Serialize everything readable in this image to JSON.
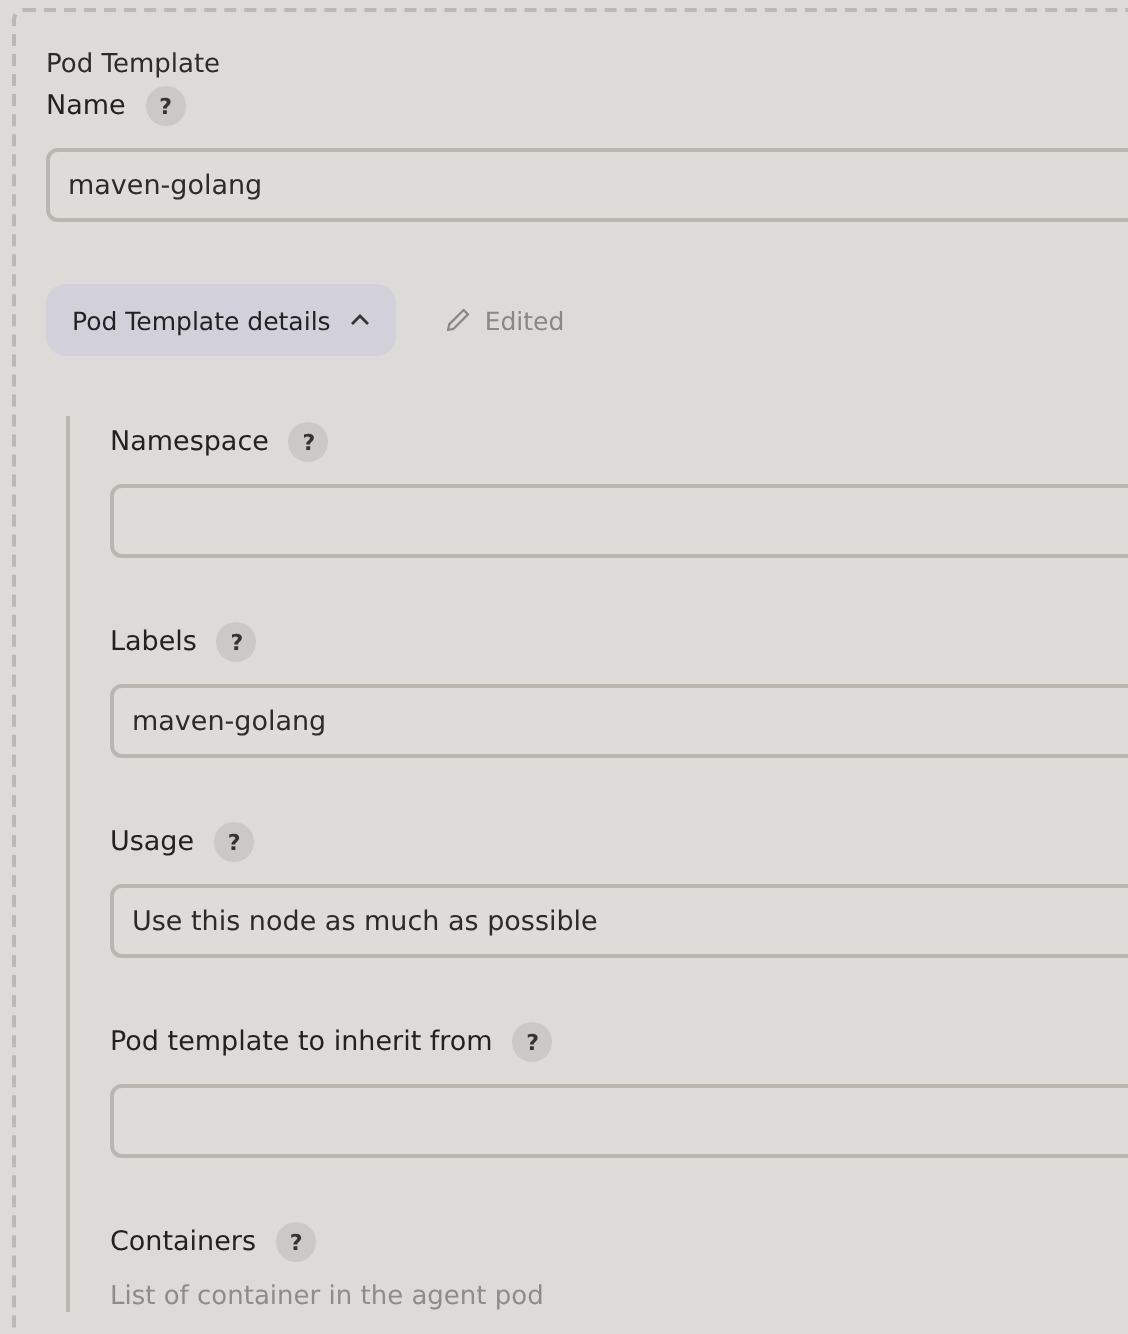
{
  "section_title": "Pod Template",
  "name_field": {
    "label": "Name",
    "help": "?",
    "value": "maven-golang"
  },
  "details_toggle": {
    "label": "Pod Template details",
    "expanded": true
  },
  "edited_note": "Edited",
  "details_fields": [
    {
      "kind": "input",
      "label": "Namespace",
      "help": "?"
    },
    {
      "kind": "input",
      "label": "Labels",
      "help": "?",
      "value": "maven-golang"
    },
    {
      "kind": "input",
      "label": "Usage",
      "help": "?",
      "value": "Use this node as much as possible"
    },
    {
      "kind": "input",
      "label": "Pod template to inherit from",
      "help": "?"
    },
    {
      "kind": "list",
      "label": "Containers",
      "help": "?",
      "description": "List of container in the agent pod"
    }
  ]
}
